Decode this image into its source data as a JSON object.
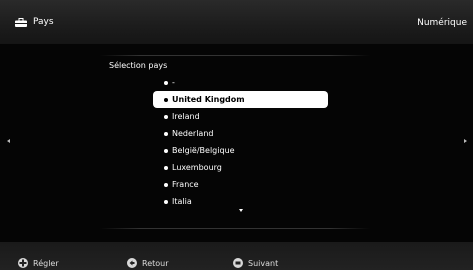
{
  "header": {
    "title": "Pays",
    "mode": "Numérique"
  },
  "section_title": "Sélection pays",
  "countries": [
    "-",
    "United Kingdom",
    "Ireland",
    "Nederland",
    "België/Belgique",
    "Luxembourg",
    "France",
    "Italia"
  ],
  "selected_country": "United Kingdom",
  "footer": {
    "adjust": "Régler",
    "back": "Retour",
    "next": "Suivant"
  },
  "colors": {
    "background": "#000000",
    "highlight": "#ffffff",
    "text": "#ffffff"
  }
}
